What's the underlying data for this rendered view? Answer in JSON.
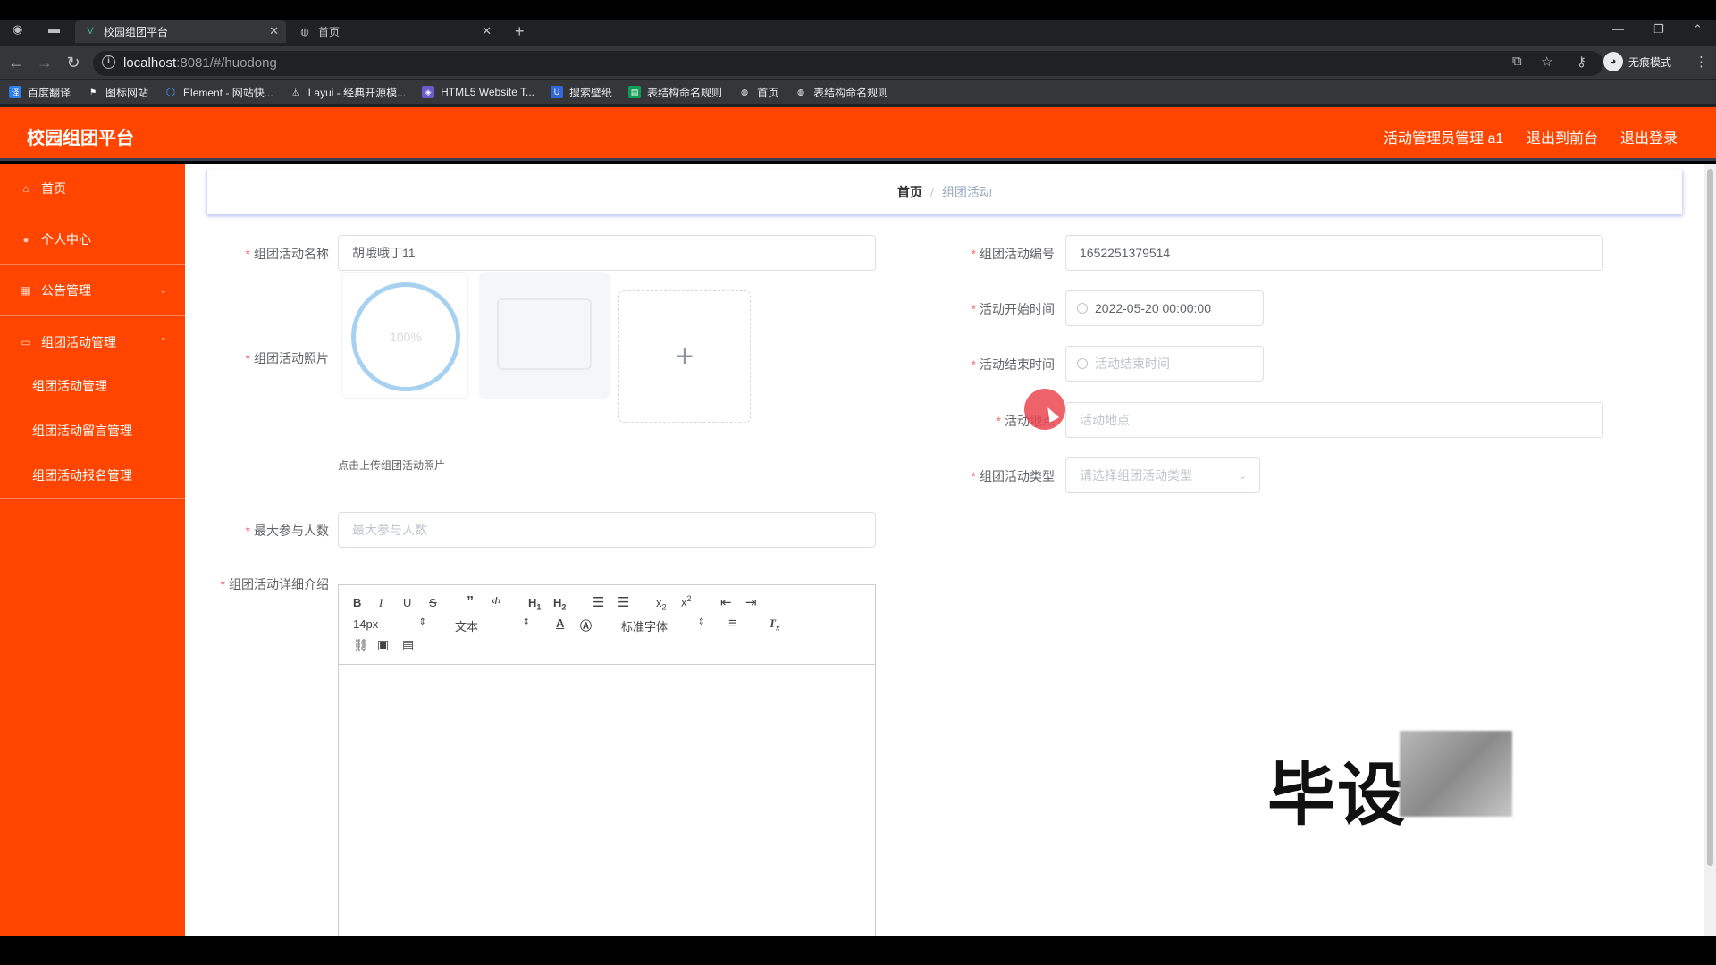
{
  "browser": {
    "tabs": [
      {
        "label": "校园组团平台",
        "active": true
      },
      {
        "label": "首页",
        "active": false
      }
    ],
    "url_host": "localhost",
    "url_rest": ":8081/#/huodong",
    "incognito_label": "无痕模式",
    "bookmarks": [
      {
        "label": "百度翻译",
        "icon": "translate-icon",
        "color": "#2b7de9"
      },
      {
        "label": "图标网站",
        "icon": "flag-icon",
        "color": "#35363a"
      },
      {
        "label": "Element - 网站快...",
        "icon": "element-icon",
        "color": "#409eff"
      },
      {
        "label": "Layui - 经典开源模...",
        "icon": "layui-icon",
        "color": "#35363a"
      },
      {
        "label": "HTML5 Website T...",
        "icon": "html5-icon",
        "color": "#6a5acd"
      },
      {
        "label": "搜索壁纸",
        "icon": "wallpaper-icon",
        "color": "#3367d6"
      },
      {
        "label": "表结构命名规则",
        "icon": "sheet-icon",
        "color": "#0f9d58"
      },
      {
        "label": "首页",
        "icon": "globe-icon",
        "color": "#35363a"
      },
      {
        "label": "表结构命名规则",
        "icon": "globe-icon",
        "color": "#35363a"
      }
    ]
  },
  "header": {
    "title": "校园组团平台",
    "user": "活动管理员管理 a1",
    "to_front": "退出到前台",
    "logout": "退出登录"
  },
  "sidebar": {
    "items": [
      {
        "label": "首页",
        "icon": "home-icon"
      },
      {
        "label": "个人中心",
        "icon": "user-icon"
      },
      {
        "label": "公告管理",
        "icon": "notice-icon"
      },
      {
        "label": "组团活动管理",
        "icon": "activity-icon"
      }
    ],
    "sub_items": [
      {
        "label": "组团活动管理"
      },
      {
        "label": "组团活动留言管理"
      },
      {
        "label": "组团活动报名管理"
      }
    ]
  },
  "breadcrumb": {
    "home": "首页",
    "separator": "/",
    "current": "组团活动"
  },
  "form": {
    "name": {
      "label": "组团活动名称",
      "value": "胡哦哦丁11"
    },
    "code": {
      "label": "组团活动编号",
      "value": "1652251379514"
    },
    "photo": {
      "label": "组团活动照片",
      "tip": "点击上传组团活动照片",
      "progress_text": "100%"
    },
    "start_time": {
      "label": "活动开始时间",
      "value": "2022-05-20 00:00:00"
    },
    "end_time": {
      "label": "活动结束时间",
      "placeholder": "活动结束时间"
    },
    "location": {
      "label": "活动地点",
      "placeholder": "活动地点"
    },
    "type": {
      "label": "组团活动类型",
      "placeholder": "请选择组团活动类型"
    },
    "max_people": {
      "label": "最大参与人数",
      "placeholder": "最大参与人数"
    },
    "detail": {
      "label": "组团活动详细介绍"
    },
    "required_mark": "*"
  },
  "editor": {
    "font_size": "14px",
    "paragraph": "文本",
    "font_family": "标准字体"
  },
  "watermark": "毕设"
}
